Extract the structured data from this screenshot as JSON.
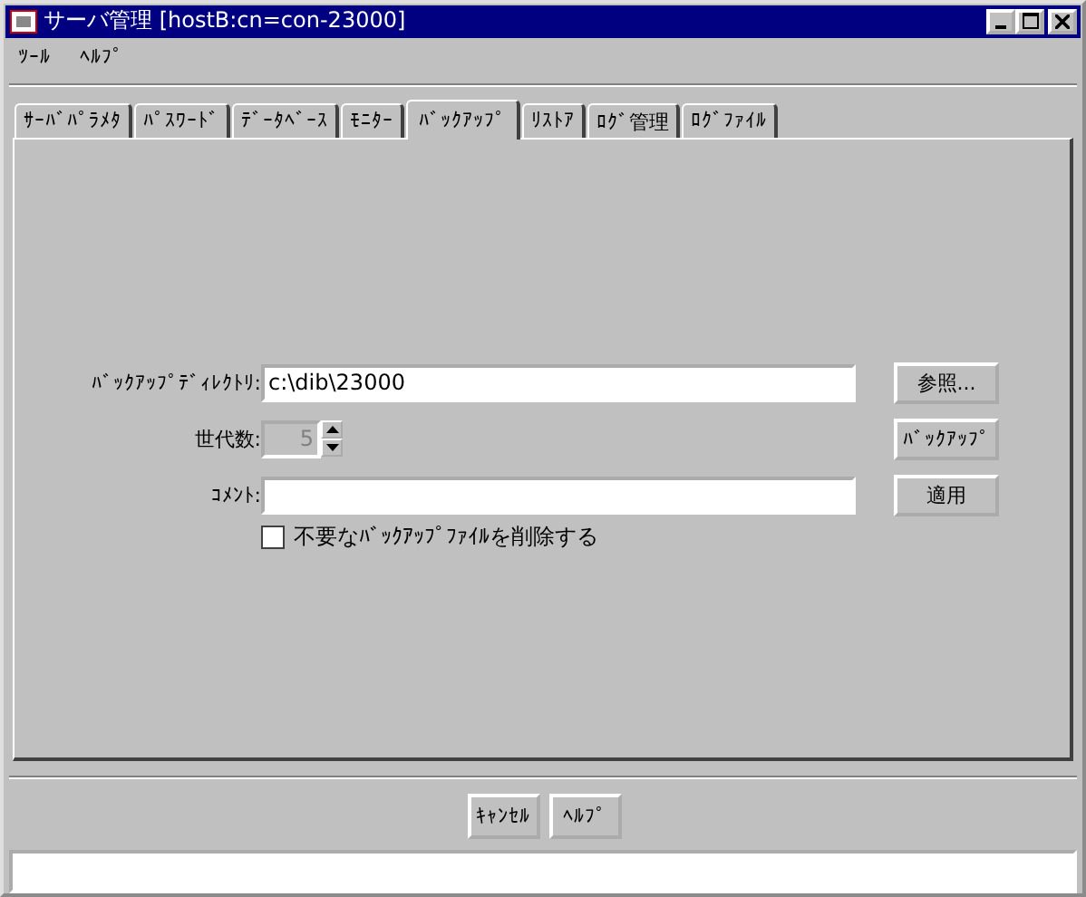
{
  "window": {
    "title": "サーバ管理 [hostB:cn=con-23000]"
  },
  "menu": [
    "ﾂｰﾙ",
    "ﾍﾙﾌﾟ"
  ],
  "tabs": [
    {
      "label": "ｻｰﾊﾞﾊﾟﾗﾒﾀ",
      "selected": false
    },
    {
      "label": "ﾊﾟｽﾜｰﾄﾞ",
      "selected": false
    },
    {
      "label": "ﾃﾞｰﾀﾍﾞｰｽ",
      "selected": false
    },
    {
      "label": "ﾓﾆﾀｰ",
      "selected": false
    },
    {
      "label": "ﾊﾞｯｸｱｯﾌﾟ",
      "selected": true
    },
    {
      "label": "ﾘｽﾄｱ",
      "selected": false
    },
    {
      "label": "ﾛｸﾞ管理",
      "selected": false
    },
    {
      "label": "ﾛｸﾞﾌｧｲﾙ",
      "selected": false
    }
  ],
  "form": {
    "directory": {
      "label": "ﾊﾞｯｸｱｯﾌﾟﾃﾞｨﾚｸﾄﾘ:",
      "value": "c:\\dib\\23000"
    },
    "generations": {
      "label": "世代数:",
      "value": "5",
      "disabled": true
    },
    "comment": {
      "label": "ｺﾒﾝﾄ:"
    },
    "delete_old": {
      "label": "不要なﾊﾞｯｸｱｯﾌﾟﾌｧｲﾙを削除する",
      "checked": false
    }
  },
  "side_buttons": [
    "参照...",
    "ﾊﾞｯｸｱｯﾌﾟ",
    "適用"
  ],
  "bottom_buttons": [
    "ｷｬﾝｾﾙ",
    "ﾍﾙﾌﾟ"
  ]
}
